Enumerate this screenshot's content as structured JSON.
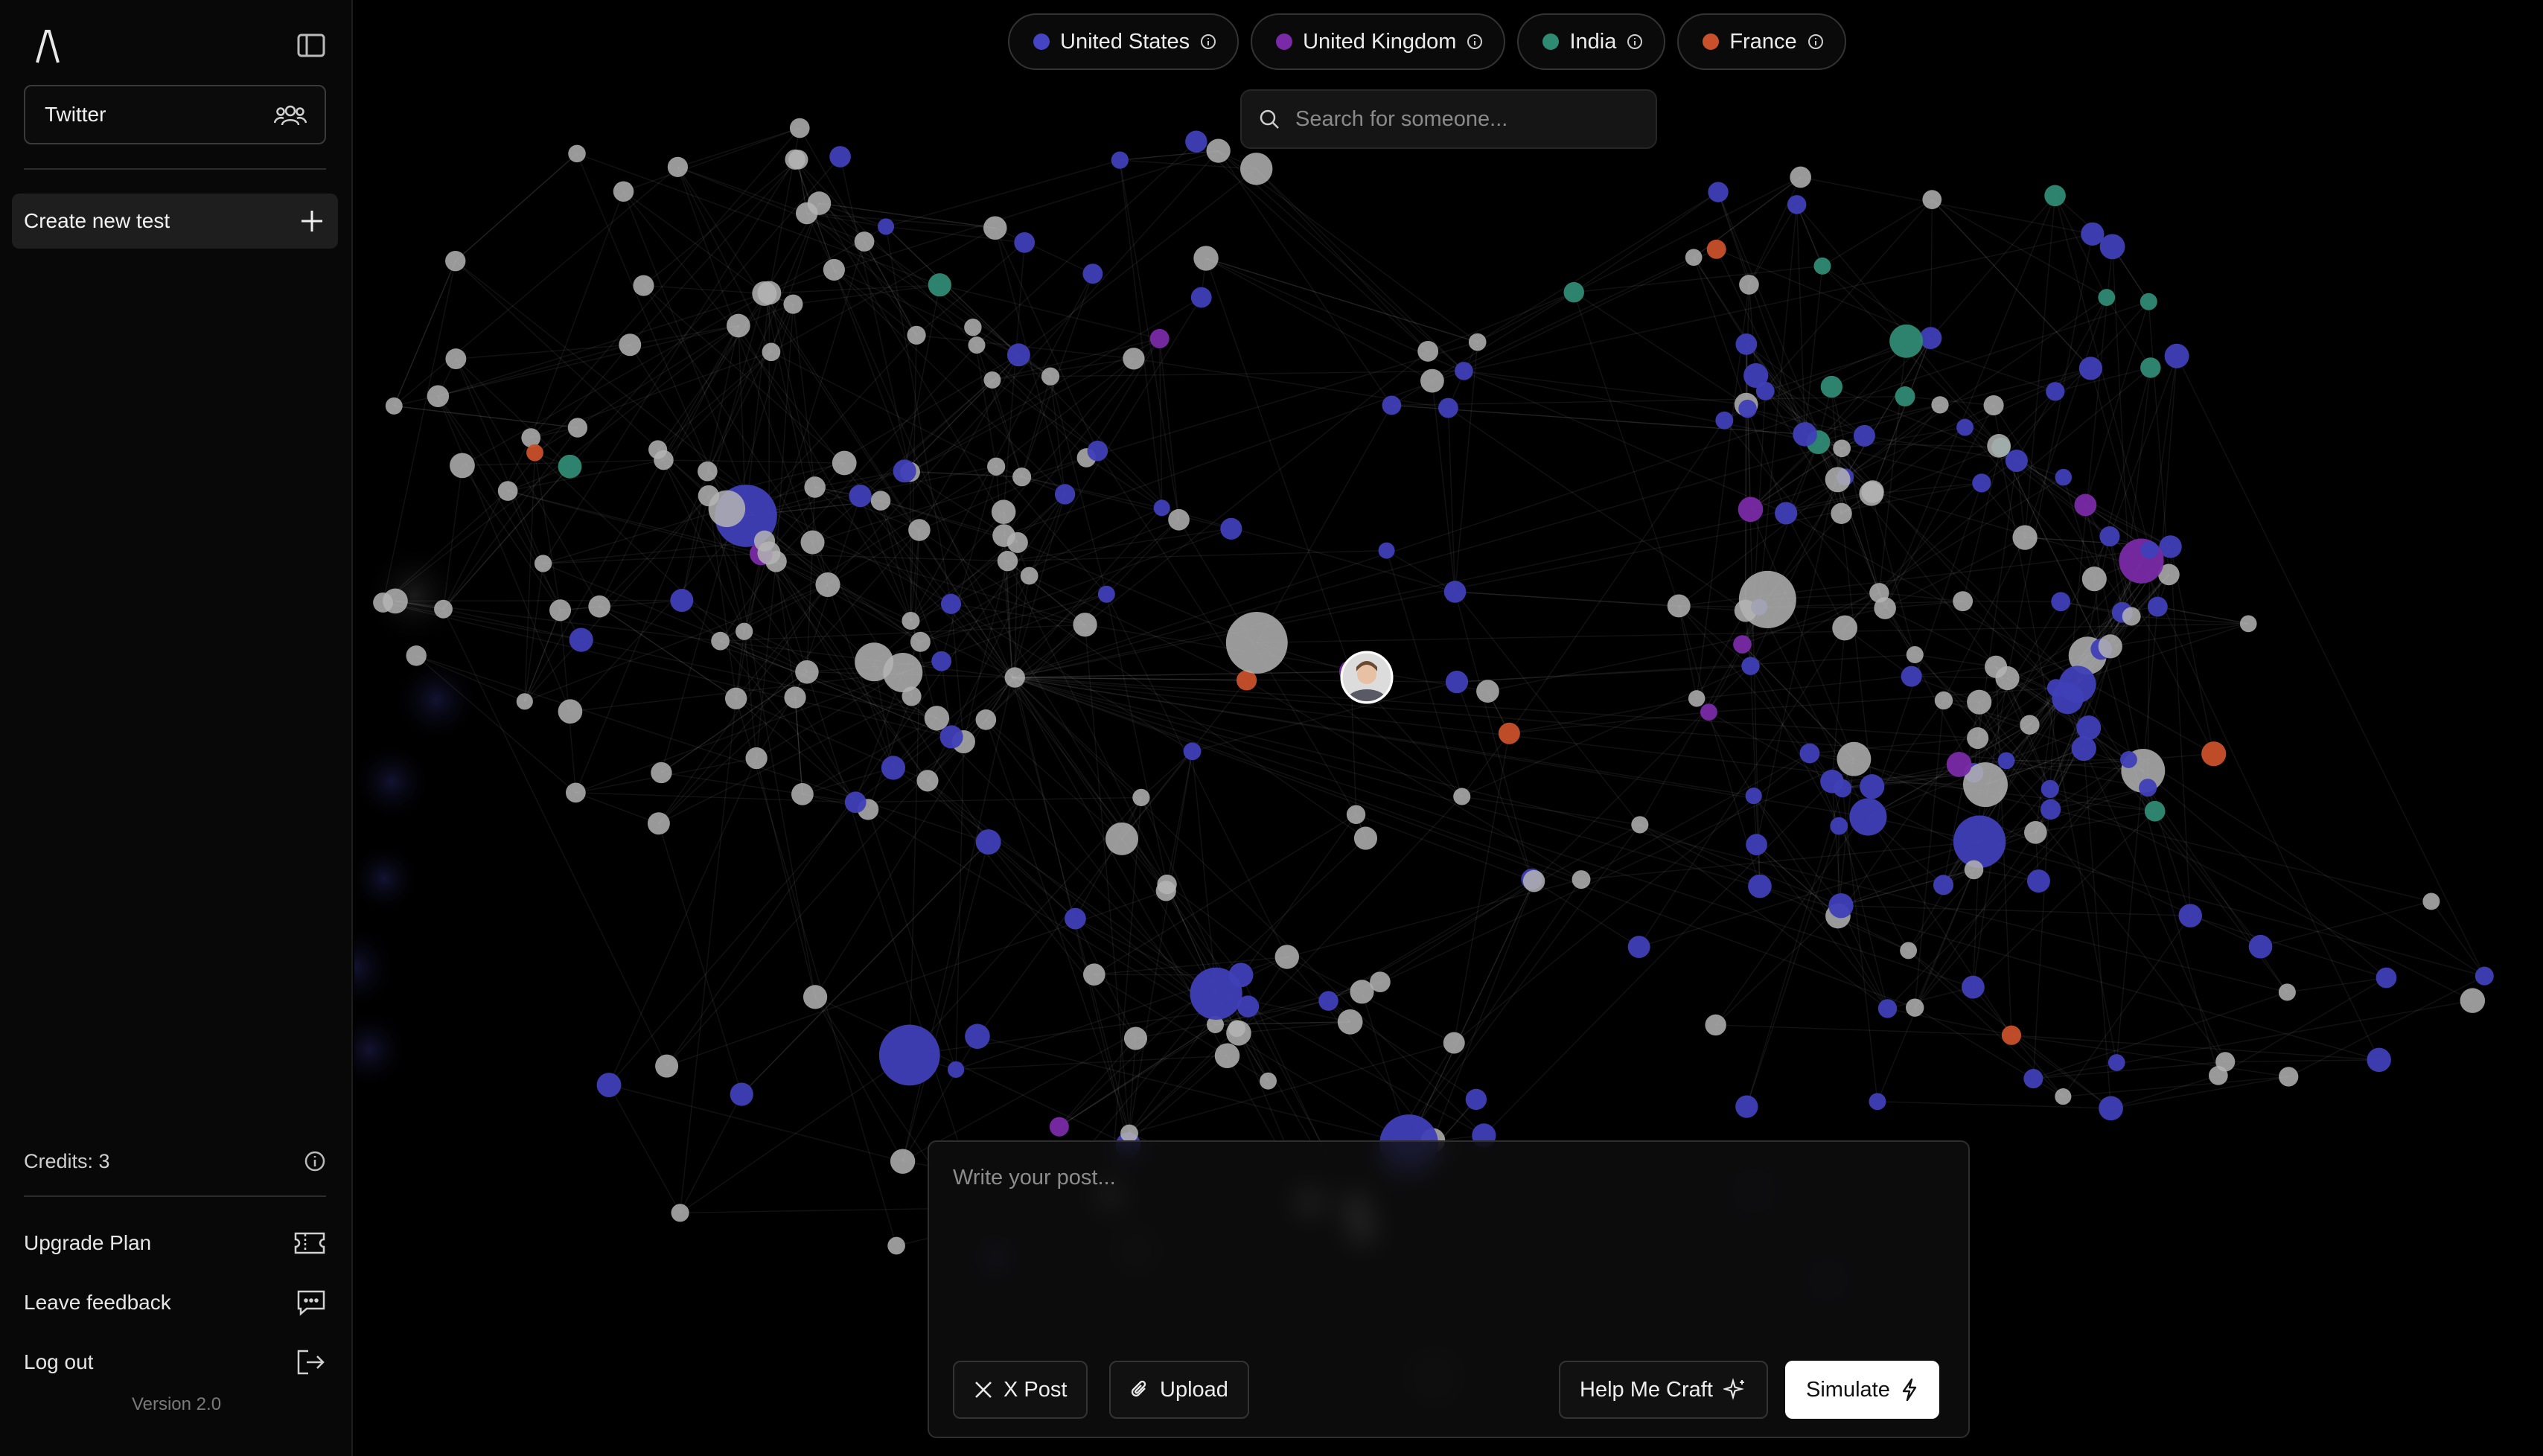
{
  "sidebar": {
    "logo_icon": "lambda-logo-icon",
    "toggle_icon": "sidebar-toggle-icon",
    "workspace": {
      "label": "Twitter",
      "icon": "users-icon"
    },
    "create_label": "Create new test",
    "credits": "Credits: 3",
    "menu": [
      {
        "label": "Upgrade Plan",
        "icon": "ticket-icon"
      },
      {
        "label": "Leave feedback",
        "icon": "message-icon"
      },
      {
        "label": "Log out",
        "icon": "logout-icon"
      }
    ],
    "version": "Version 2.0"
  },
  "legend": [
    {
      "label": "United States",
      "color": "#3f3fb8"
    },
    {
      "label": "United Kingdom",
      "color": "#7a2aa6"
    },
    {
      "label": "India",
      "color": "#2f8a74"
    },
    {
      "label": "France",
      "color": "#c8502a"
    }
  ],
  "search": {
    "placeholder": "Search for someone..."
  },
  "composer": {
    "placeholder": "Write your post...",
    "x_post_label": "X Post",
    "upload_label": "Upload",
    "craft_label": "Help Me Craft",
    "simulate_label": "Simulate"
  },
  "colors": {
    "neutral_node": "#b4b4b4",
    "us": "#3f3fb8",
    "uk": "#7a2aa6",
    "india": "#2f8a74",
    "france": "#c8502a"
  }
}
